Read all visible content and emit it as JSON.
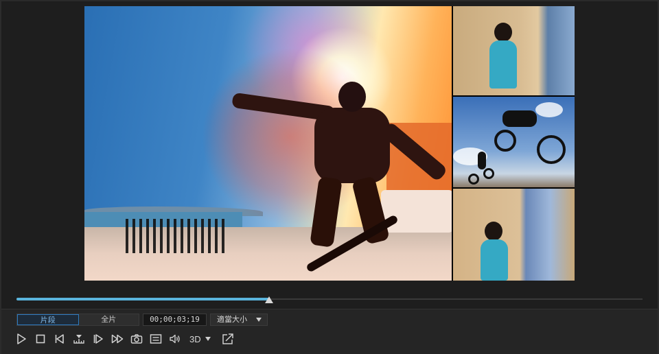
{
  "player": {
    "mode_tabs": [
      {
        "label": "片段",
        "active": true
      },
      {
        "label": "全片",
        "active": false
      }
    ],
    "timecode": "00;00;03;19",
    "zoom": {
      "label": "適當大小"
    },
    "progress_fraction": 0.403,
    "three_d_label": "3D"
  },
  "icons": {
    "play": "play-icon",
    "stop": "stop-icon",
    "prev_frame": "previous-frame-icon",
    "split": "split-icon",
    "next_frame": "next-frame-icon",
    "fast_forward": "fast-forward-icon",
    "snapshot": "camera-icon",
    "subtitles": "subtitles-icon",
    "volume": "volume-icon",
    "popout": "undock-window-icon"
  },
  "colors": {
    "progress": "#5ab4dc",
    "active_tab_border": "#2e7bc0",
    "background": "#1e1e1e"
  }
}
